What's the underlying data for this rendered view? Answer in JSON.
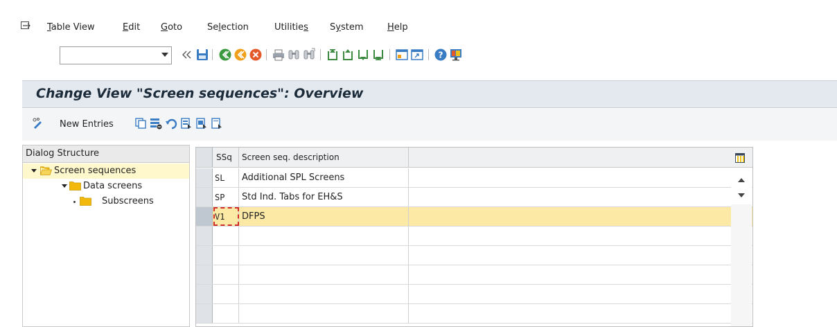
{
  "menu": {
    "items": [
      {
        "key": "table_view",
        "prefix": "",
        "underline": "T",
        "rest": "able View"
      },
      {
        "key": "edit",
        "prefix": "",
        "underline": "E",
        "rest": "dit"
      },
      {
        "key": "goto",
        "prefix": "",
        "underline": "G",
        "rest": "oto"
      },
      {
        "key": "selection",
        "prefix": "Se",
        "underline": "l",
        "rest": "ection"
      },
      {
        "key": "utilities",
        "prefix": "Utilitie",
        "underline": "s",
        "rest": ""
      },
      {
        "key": "system",
        "prefix": "S",
        "underline": "y",
        "rest": "stem"
      },
      {
        "key": "help",
        "prefix": "",
        "underline": "H",
        "rest": "elp"
      }
    ]
  },
  "toolbar": {
    "command_field_value": "",
    "icons": [
      "enter-check-icon",
      "collapse-icon",
      "save-icon",
      "back-icon",
      "exit-icon",
      "cancel-icon",
      "print-icon",
      "find-icon",
      "find-next-icon",
      "first-page-icon",
      "previous-page-icon",
      "next-page-icon",
      "last-page-icon",
      "create-session-icon",
      "shortcut-icon",
      "help-icon",
      "customize-layout-icon"
    ]
  },
  "title": "Change View \"Screen sequences\": Overview",
  "app_toolbar": {
    "new_entries": "New Entries",
    "icons": [
      "display-change-icon",
      "copy-as-icon",
      "delete-icon",
      "undo-icon",
      "select-all-icon",
      "select-block-icon",
      "deselect-all-icon"
    ]
  },
  "dialog_structure": {
    "header": "Dialog Structure",
    "items": [
      {
        "label": "Screen sequences",
        "level": 0,
        "expanded": true,
        "selected": true,
        "open_folder": true
      },
      {
        "label": "Data screens",
        "level": 1,
        "expanded": true,
        "selected": false,
        "open_folder": false
      },
      {
        "label": "Subscreens",
        "level": 2,
        "expanded": false,
        "selected": false,
        "open_folder": false
      }
    ]
  },
  "table": {
    "columns": [
      "SSq",
      "Screen seq. description"
    ],
    "rows": [
      {
        "ssq": "SL",
        "desc": "Additional SPL Screens"
      },
      {
        "ssq": "SP",
        "desc": "Std Ind. Tabs for EH&S"
      },
      {
        "ssq": "V1",
        "desc": "DFPS"
      }
    ],
    "empty_rows": 5,
    "highlighted_row": 2
  },
  "colors": {
    "title_bar_bg": "#e4e9ef",
    "selected_tree_bg": "#fff8cc",
    "highlight_row_bg": "#fde9a6",
    "folder_yellow": "#f2b90c",
    "enter_green": "#2e9a3a"
  }
}
